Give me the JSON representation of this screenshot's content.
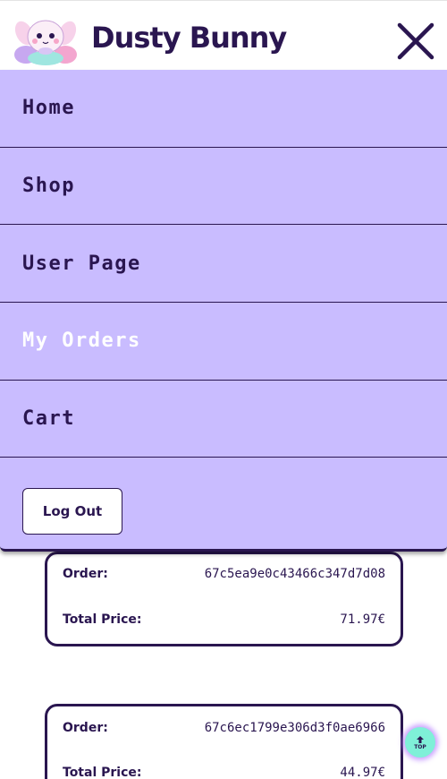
{
  "header": {
    "brand": "Dusty Bunny",
    "logo_icon": "bunny-on-clouds-logo",
    "close_icon": "close-icon"
  },
  "menu": {
    "items": [
      {
        "label": "Home",
        "active": false
      },
      {
        "label": "Shop",
        "active": false
      },
      {
        "label": "User Page",
        "active": false
      },
      {
        "label": "My Orders",
        "active": true
      },
      {
        "label": "Cart",
        "active": false
      }
    ],
    "logout_label": "Log Out"
  },
  "orders": [
    {
      "order_label": "Order:",
      "order_id": "67c5ea9e0c43466c347d7d08",
      "price_label": "Total Price:",
      "total_price": "71.97€"
    },
    {
      "order_label": "Order:",
      "order_id": "67c6ec1799e306d3f0ae6966",
      "price_label": "Total Price:",
      "total_price": "44.97€"
    }
  ],
  "scroll_top": {
    "label": "TOP",
    "icon": "arrow-up-icon"
  },
  "colors": {
    "primary": "#2a1650",
    "menu_bg": "#c9bcff",
    "active_text": "#ffffff",
    "top_button": "#7ff0d8"
  }
}
